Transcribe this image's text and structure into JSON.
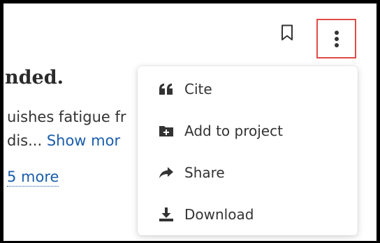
{
  "article": {
    "heading_fragment": "nded.",
    "line1_fragment": "uishes fatigue fr",
    "line2_fragment": "dis... ",
    "show_more": "Show mor",
    "more_link": "5 more"
  },
  "toolbar": {
    "bookmark_icon": "bookmark-icon",
    "more_icon": "vertical-dots-icon",
    "highlight_color": "#e24b48"
  },
  "menu": {
    "items": [
      {
        "label": "Cite",
        "icon": "quote-icon"
      },
      {
        "label": "Add to project",
        "icon": "folder-plus-icon"
      },
      {
        "label": "Share",
        "icon": "share-arrow-icon"
      },
      {
        "label": "Download",
        "icon": "download-icon"
      }
    ]
  }
}
